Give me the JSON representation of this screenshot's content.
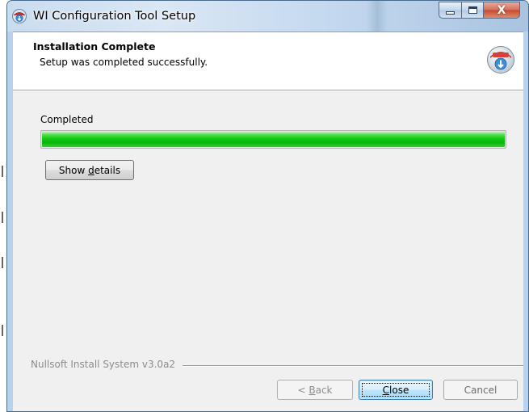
{
  "window": {
    "title": "WI Configuration Tool Setup",
    "icon": "installer-icon",
    "controls": [
      "minimize-icon",
      "maximize-icon",
      "close-icon"
    ],
    "close_glyph": "X"
  },
  "header": {
    "title": "Installation Complete",
    "subtitle": "Setup was completed successfully.",
    "icon": "nsis-installer-icon"
  },
  "progress": {
    "status": "Completed",
    "percent": 100,
    "color": "#14c914"
  },
  "buttons": {
    "show_details_prefix": "Show ",
    "show_details_accel": "d",
    "show_details_suffix": "etails",
    "back_prefix": "< ",
    "back_accel": "B",
    "back_suffix": "ack",
    "close_accel": "C",
    "close_suffix": "lose",
    "cancel": "Cancel"
  },
  "footer": {
    "branding": "Nullsoft Install System v3.0a2"
  }
}
